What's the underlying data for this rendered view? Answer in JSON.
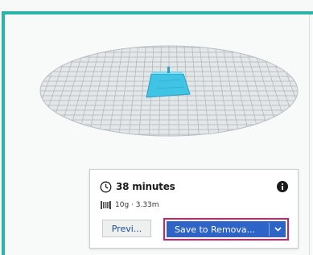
{
  "print_job": {
    "time_estimate": "38 minutes",
    "material_estimate": "10g · 3.33m",
    "preview_label": "Previ...",
    "save_label": "Save to Remova..."
  },
  "icons": {
    "time": "clock-icon",
    "material": "filament-spool-icon",
    "info": "info-icon",
    "dropdown": "chevron-down-icon"
  },
  "colors": {
    "accent_frame": "#2bb3a6",
    "model": "#3fc4e6",
    "primary_button": "#2e63c7",
    "highlight_outline": "#d0206f"
  }
}
